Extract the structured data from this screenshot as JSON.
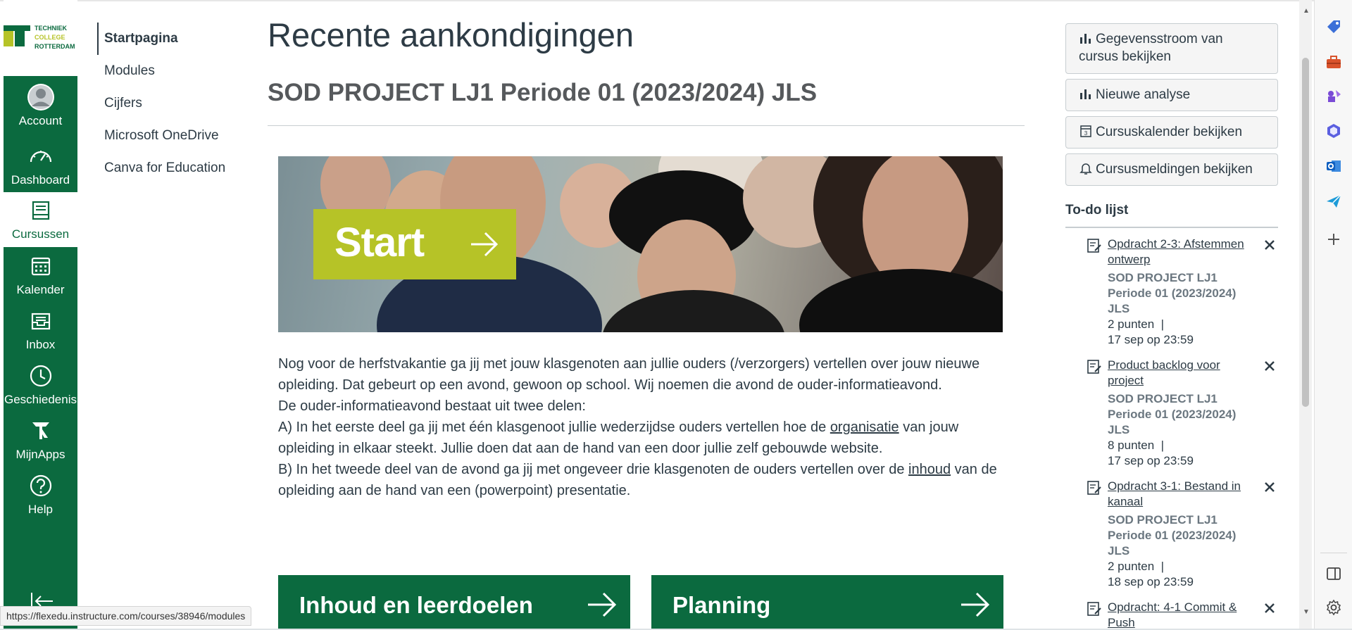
{
  "logo": {
    "lines": [
      "TECHNIEK",
      "COLLEGE",
      "ROTTERDAM"
    ]
  },
  "global_nav": {
    "items": [
      {
        "label": "Account",
        "icon": "account-avatar-icon"
      },
      {
        "label": "Dashboard",
        "icon": "dashboard-icon"
      },
      {
        "label": "Cursussen",
        "icon": "courses-icon",
        "active": true
      },
      {
        "label": "Kalender",
        "icon": "calendar-icon"
      },
      {
        "label": "Inbox",
        "icon": "inbox-icon"
      },
      {
        "label": "Geschiedenis",
        "icon": "history-icon"
      },
      {
        "label": "MijnApps",
        "icon": "apps-icon"
      },
      {
        "label": "Help",
        "icon": "help-icon"
      }
    ]
  },
  "course_nav": {
    "items": [
      "Startpagina",
      "Modules",
      "Cijfers",
      "Microsoft OneDrive",
      "Canva for Education"
    ]
  },
  "main": {
    "page_title": "Recente aankondigingen",
    "course_title": "SOD PROJECT LJ1 Periode 01 (2023/2024) JLS",
    "banner": {
      "button_label": "Start"
    },
    "body": {
      "p1": "Nog voor de herfstvakantie ga jij met jouw klasgenoten aan jullie ouders (/verzorgers) vertellen over jouw nieuwe opleiding. Dat gebeurt op een avond, gewoon op school. Wij noemen die avond de ouder-informatieavond.",
      "p2": "De ouder-informatieavond bestaat uit twee delen:",
      "p3_a": "A) In het eerste deel ga jij met één klasgenoot jullie wederzijdse ouders vertellen hoe de ",
      "p3_link": "organisatie",
      "p3_b": " van jouw opleiding in elkaar steekt. Jullie doen dat aan de hand van een door jullie zelf gebouwde website.",
      "p4_a": "B) In het tweede deel van de avond ga jij met ongeveer drie klasgenoten de ouders vertellen over de ",
      "p4_link": "inhoud",
      "p4_b": " van de opleiding aan de hand van een (powerpoint) presentatie."
    },
    "tiles": [
      "Inhoud en leerdoelen",
      "Planning"
    ]
  },
  "sidebar": {
    "buttons": [
      {
        "label": "Gegevensstroom van cursus bekijken",
        "icon": "bar-chart-icon"
      },
      {
        "label": "Nieuwe analyse",
        "icon": "bar-chart-icon"
      },
      {
        "label": "Cursuskalender bekijken",
        "icon": "calendar-icon"
      },
      {
        "label": "Cursusmeldingen bekijken",
        "icon": "bell-icon"
      }
    ],
    "todo_heading": "To-do lijst",
    "todos": [
      {
        "title": "Opdracht 2-3: Afstemmen ontwerp",
        "course": "SOD PROJECT LJ1 Periode 01 (2023/2024) JLS",
        "points": "2 punten",
        "separator": "|",
        "due": "17 sep op 23:59"
      },
      {
        "title": "Product backlog voor project",
        "course": "SOD PROJECT LJ1 Periode 01 (2023/2024) JLS",
        "points": "8 punten",
        "separator": "|",
        "due": "17 sep op 23:59"
      },
      {
        "title": "Opdracht 3-1: Bestand in kanaal",
        "course": "SOD PROJECT LJ1 Periode 01 (2023/2024) JLS",
        "points": "2 punten",
        "separator": "|",
        "due": "18 sep op 23:59"
      },
      {
        "title": "Opdracht: 4-1 Commit & Push"
      }
    ]
  },
  "status_bar": {
    "url": "https://flexedu.instructure.com/courses/38946/modules"
  },
  "colors": {
    "brand_green": "#0b6a3f",
    "accent_lime": "#b6c327"
  }
}
